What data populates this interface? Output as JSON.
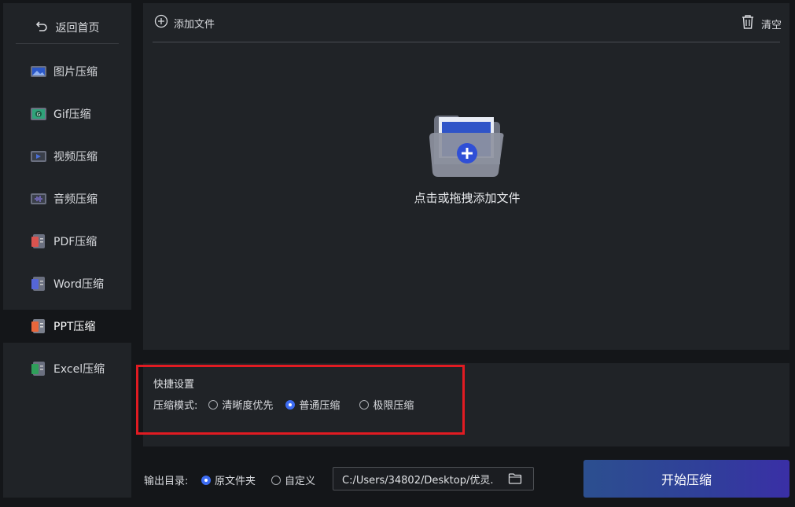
{
  "sidebar": {
    "back_label": "返回首页",
    "items": [
      {
        "label": "图片压缩",
        "icon": "image-compress-icon",
        "color": "#4a7be0"
      },
      {
        "label": "Gif压缩",
        "icon": "gif-compress-icon",
        "color": "#2fa37a"
      },
      {
        "label": "视频压缩",
        "icon": "video-compress-icon",
        "color": "#4a6fd8"
      },
      {
        "label": "音频压缩",
        "icon": "audio-compress-icon",
        "color": "#6d5bd0"
      },
      {
        "label": "PDF压缩",
        "icon": "pdf-compress-icon",
        "color": "#d9534f"
      },
      {
        "label": "Word压缩",
        "icon": "word-compress-icon",
        "color": "#5566d6"
      },
      {
        "label": "PPT压缩",
        "icon": "ppt-compress-icon",
        "color": "#e8673c",
        "active": true
      },
      {
        "label": "Excel压缩",
        "icon": "excel-compress-icon",
        "color": "#2f9e5a"
      }
    ]
  },
  "toolbar": {
    "add_file_label": "添加文件",
    "clear_label": "清空"
  },
  "drop_zone": {
    "hint": "点击或拖拽添加文件"
  },
  "settings": {
    "title": "快捷设置",
    "mode_label": "压缩模式:",
    "modes": [
      {
        "label": "清晰度优先",
        "checked": false
      },
      {
        "label": "普通压缩",
        "checked": true
      },
      {
        "label": "极限压缩",
        "checked": false
      }
    ]
  },
  "output": {
    "label": "输出目录:",
    "options": [
      {
        "label": "原文件夹",
        "checked": true
      },
      {
        "label": "自定义",
        "checked": false
      }
    ],
    "path": "C:/Users/34802/Desktop/优灵."
  },
  "start_button": "开始压缩",
  "colors": {
    "accent": "#3d6cf2",
    "highlight": "#e11b22",
    "panel": "#202327",
    "background": "#141619"
  }
}
